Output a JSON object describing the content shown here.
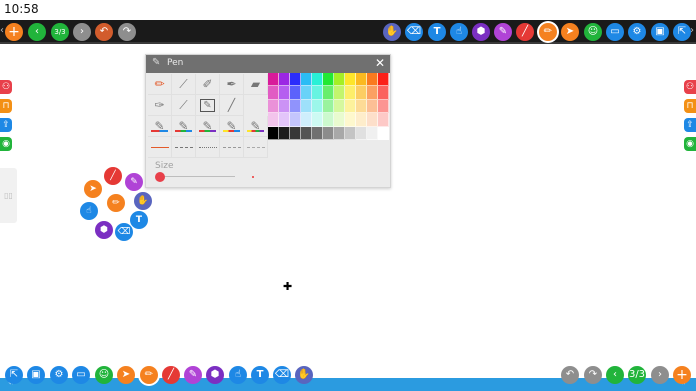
{
  "status": {
    "time": "10:58"
  },
  "colors": {
    "green": "#21b43b",
    "orange": "#f39015",
    "gray": "#8e8e8e",
    "brown": "#d25c2c",
    "purple": "#7b2fc2",
    "blue": "#1e88e5",
    "lavender": "#5965bf",
    "magenta": "#b043d6",
    "red": "#e53935",
    "pink": "#e91e63",
    "teal": "#22a2d3",
    "accent_orange": "#f5811f"
  },
  "top_toolbar": {
    "page_counter": "3/3",
    "text_tool": "T"
  },
  "pen_panel": {
    "title": "Pen",
    "size_label": "Size",
    "palette": {
      "rows": [
        [
          "#d81b9a",
          "#9b27e4",
          "#2b2dfb",
          "#2abcf5",
          "#29f0d6",
          "#22e833",
          "#a4ef25",
          "#fde52a",
          "#fbb920",
          "#fa7a1f",
          "#fb2018"
        ],
        [
          "#e15cc3",
          "#b55ff0",
          "#5c62fb",
          "#69d2f8",
          "#67f4e1",
          "#68ee6d",
          "#c2f56d",
          "#fdee6a",
          "#fccd63",
          "#fba062",
          "#fb635e"
        ],
        [
          "#ea91d8",
          "#cb92f5",
          "#9093fc",
          "#9ee0fa",
          "#9cf7ea",
          "#9af39e",
          "#d5f89e",
          "#fdf29c",
          "#fddb96",
          "#fcbf95",
          "#fc9592"
        ],
        [
          "#f3c4ec",
          "#e3c5fa",
          "#c4c5fd",
          "#cfeefc",
          "#cdfaf3",
          "#ccf9ce",
          "#e9fbcf",
          "#fef8cd",
          "#feedcb",
          "#fddfca",
          "#fdc9c7"
        ],
        [
          "#000000",
          "#1c1c1c",
          "#383838",
          "#545454",
          "#707070",
          "#8c8c8c",
          "#a8a8a8",
          "#c4c4c4",
          "#e0e0e0",
          "#f0f0f0",
          "#ffffff"
        ]
      ]
    }
  },
  "radial_menu": {
    "text_tool": "T"
  },
  "bottom_toolbar": {
    "page_counter": "3/3",
    "text_tool": "T"
  }
}
